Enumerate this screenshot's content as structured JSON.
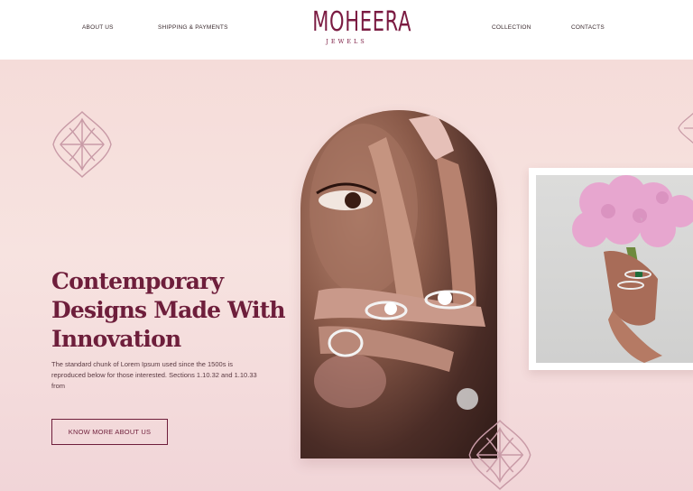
{
  "brand": {
    "name": "MOHEERA",
    "tagline": "JEWELS"
  },
  "nav": {
    "left": [
      {
        "label": "ABOUT US"
      },
      {
        "label": "SHIPPING & PAYMENTS"
      }
    ],
    "right": [
      {
        "label": "COLLECTION"
      },
      {
        "label": "CONTACTS"
      }
    ]
  },
  "hero": {
    "title": "Contemporary Designs Made With Innovation",
    "description": "The standard chunk of Lorem Ipsum used since the 1500s is reproduced below for those interested. Sections 1.10.32 and 1.10.33 from",
    "cta_label": "KNOW MORE ABOUT US"
  },
  "colors": {
    "accent": "#7b1b42",
    "background": "#f6e4e2",
    "ornament": "#c89aa6"
  },
  "icons": {
    "ornament": "rhombus-flower-icon"
  }
}
